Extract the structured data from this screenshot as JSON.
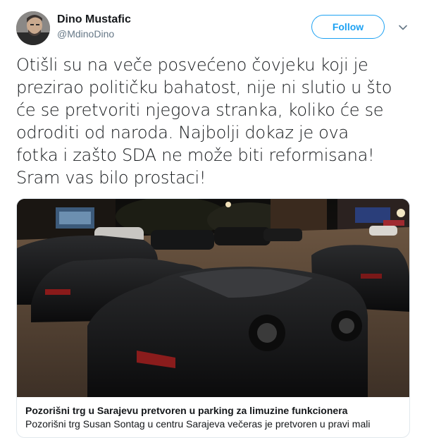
{
  "author": {
    "name": "Dino Mustafic",
    "handle": "@MdinoDino"
  },
  "follow_button": {
    "label": "Follow"
  },
  "tweet": {
    "text": "Otišli su na veče posvećeno čovjeku koji je\nprezirao političku bahatost, nije ni slutio u što\nće se pretvoriti njegova stranka, koliko će se\nodroditi od naroda. Najbolji dokaz je ova\nfotka i zašto SDA ne može biti reformisana!\nSram vas bilo prostaci!"
  },
  "link_card": {
    "title": "Pozorišni trg u Sarajevu pretvoren u parking za limuzine funkcionera",
    "description": "Pozorišni trg Susan Sontag u centru Sarajeva večeras je pretvoren u pravi mali"
  },
  "icons": {
    "avatar": "avatar",
    "more": "chevron-down-icon"
  },
  "colors": {
    "accent": "#1da1f2",
    "text": "#14171a",
    "secondary_text": "#657786",
    "border": "#e1e8ed"
  }
}
